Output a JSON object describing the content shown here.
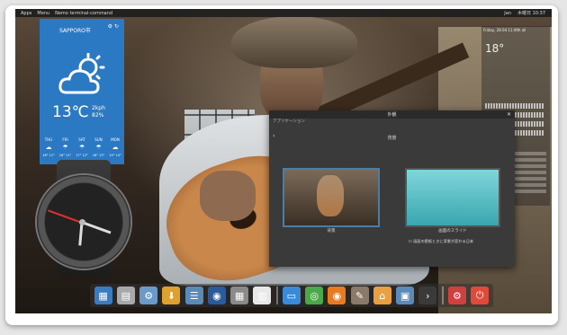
{
  "panel": {
    "left_items": [
      "Apps",
      "Menu",
      "Nemo terminal-command"
    ],
    "right_items": [
      "Jan",
      "木曜日 10:37"
    ]
  },
  "weather": {
    "city": "SAPPORO市",
    "temp": "13℃",
    "wind": "2kph",
    "humidity": "82%",
    "forecast": [
      {
        "day": "THU",
        "icon": "cloud-icon",
        "range": "18° 12°"
      },
      {
        "day": "FRI",
        "icon": "rain-icon",
        "range": "16° 11°"
      },
      {
        "day": "SAT",
        "icon": "rain-icon",
        "range": "17° 12°"
      },
      {
        "day": "SUN",
        "icon": "rain-icon",
        "range": "18° 13°"
      },
      {
        "day": "MON",
        "icon": "cloud-icon",
        "range": "19° 14°"
      }
    ],
    "color": "#2b79c2"
  },
  "conky": {
    "header": "Friday, 28 04 11:49h all",
    "temp": "18°"
  },
  "dialog": {
    "window_title": "外観",
    "app_title": "アプリケーション",
    "section": "背景",
    "option1_caption": "背景",
    "option2_caption": "画面のスライド",
    "checkbox_text": "☐ 画面の壁紙ときに背景が変わる日本"
  },
  "dock": {
    "items": [
      {
        "name": "apps-icon",
        "color": "#3a7cc2"
      },
      {
        "name": "files-icon",
        "color": "#a8a8a8"
      },
      {
        "name": "settings-icon",
        "color": "#6a9ac8"
      },
      {
        "name": "download-icon",
        "color": "#e0a030"
      },
      {
        "name": "tweak-icon",
        "color": "#5a8ab8"
      },
      {
        "name": "terminal-blue-icon",
        "color": "#2a5a9a"
      },
      {
        "name": "calculator-icon",
        "color": "#8a8a8a"
      },
      {
        "name": "calendar-icon",
        "color": "#e8e8e8"
      },
      {
        "name": "document-icon",
        "color": "#3a8ad8"
      },
      {
        "name": "chrome-icon",
        "color": "#4aaa4a"
      },
      {
        "name": "firefox-icon",
        "color": "#e87a20"
      },
      {
        "name": "gimp-icon",
        "color": "#8a7a6a"
      },
      {
        "name": "home-icon",
        "color": "#e8a040"
      },
      {
        "name": "monitor-icon",
        "color": "#5a8ab8"
      },
      {
        "name": "console-icon",
        "color": "#3a3a3a"
      },
      {
        "name": "system-settings-icon",
        "color": "#d04040"
      },
      {
        "name": "power-icon",
        "color": "#e04a3a"
      }
    ]
  }
}
